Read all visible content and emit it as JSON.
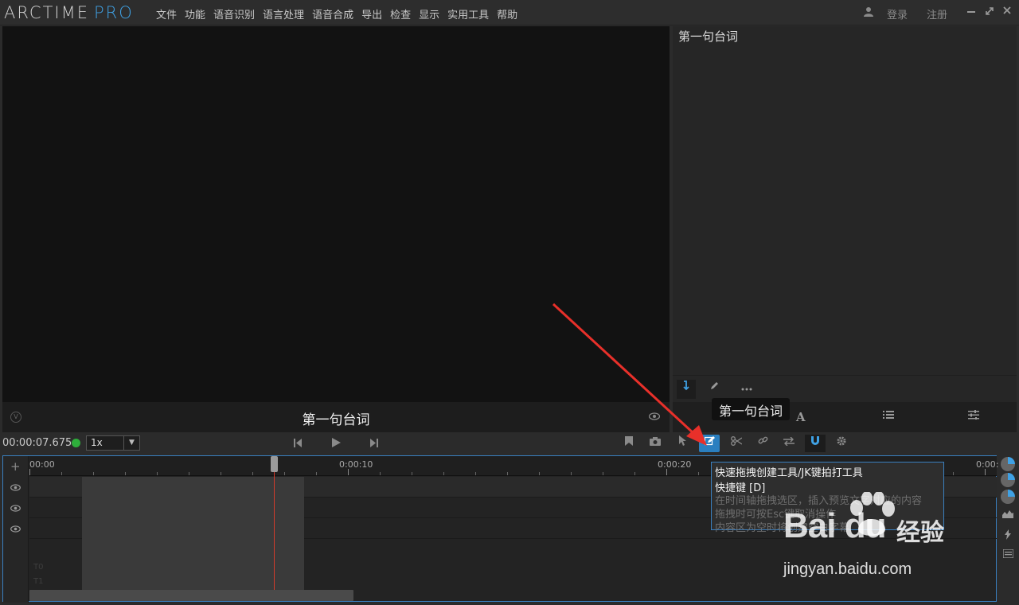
{
  "app": {
    "logo_main": "ARCTIME",
    "logo_pro": "PRO"
  },
  "menu": [
    "文件",
    "功能",
    "语音识别",
    "语言处理",
    "语音合成",
    "导出",
    "检查",
    "显示",
    "实用工具",
    "帮助"
  ],
  "account": {
    "login": "登录",
    "register": "注册"
  },
  "video": {
    "caption": "第一句台词",
    "badge": "V"
  },
  "right_panel": {
    "text": "第一句台词"
  },
  "transport": {
    "timecode": "00:00:07.675",
    "speed": "1x"
  },
  "timeline": {
    "ruler_labels": [
      "00:00",
      "0:00:10",
      "0:00:20",
      "0:00:"
    ],
    "track_labels": [
      "T0",
      "T1"
    ]
  },
  "caption_tooltip": "第一句台词",
  "tooltip": {
    "title": "快速拖拽创建工具/JK键拍打工具",
    "shortcut": "快捷键 [D]",
    "line1": "在时间轴拖拽选区，插入预览文字对应的内容",
    "line2": "拖拽时可按Esc键取消操作",
    "line3": "内容区为空时将创建空白字幕"
  },
  "watermark": {
    "brand": "Bai du",
    "jingyan": "经验",
    "url": "jingyan.baidu.com"
  },
  "colors": {
    "accent": "#3fa1e4",
    "active_tool": "#2a7fc0",
    "playhead": "#d23b2b",
    "annotation_arrow": "#e8302a"
  }
}
